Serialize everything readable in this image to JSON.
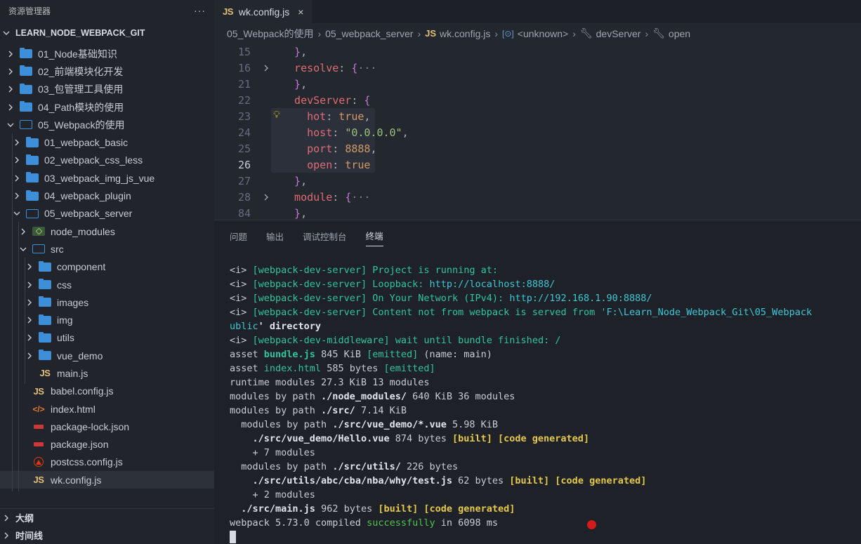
{
  "sidebar": {
    "title": "资源管理器",
    "more": "···",
    "project": "LEARN_NODE_WEBPACK_GIT",
    "tree": [
      {
        "label": "01_Node基础知识"
      },
      {
        "label": "02_前端模块化开发"
      },
      {
        "label": "03_包管理工具使用"
      },
      {
        "label": "04_Path模块的使用"
      },
      {
        "label": "05_Webpack的使用"
      },
      {
        "label": "01_webpack_basic"
      },
      {
        "label": "02_webpack_css_less"
      },
      {
        "label": "03_webpack_img_js_vue"
      },
      {
        "label": "04_webpack_plugin"
      },
      {
        "label": "05_webpack_server"
      },
      {
        "label": "node_modules"
      },
      {
        "label": "src"
      },
      {
        "label": "component"
      },
      {
        "label": "css"
      },
      {
        "label": "images"
      },
      {
        "label": "img"
      },
      {
        "label": "utils"
      },
      {
        "label": "vue_demo"
      },
      {
        "label": "main.js"
      },
      {
        "label": "babel.config.js"
      },
      {
        "label": "index.html"
      },
      {
        "label": "package-lock.json"
      },
      {
        "label": "package.json"
      },
      {
        "label": "postcss.config.js"
      },
      {
        "label": "wk.config.js"
      }
    ],
    "outline": "大纲",
    "timeline": "时间线"
  },
  "editor": {
    "tab": {
      "icon": "JS",
      "label": "wk.config.js",
      "close": "×"
    },
    "breadcrumb": [
      "05_Webpack的使用",
      "05_webpack_server",
      "wk.config.js",
      "<unknown>",
      "devServer",
      "open"
    ],
    "breadcrumb_js": "JS",
    "lines": [
      {
        "n": "15",
        "text": "  },"
      },
      {
        "n": "16",
        "text": "  resolve: {···"
      },
      {
        "n": "21",
        "text": "  },"
      },
      {
        "n": "22",
        "text": "  devServer: {"
      },
      {
        "n": "23",
        "text": "    hot: true,"
      },
      {
        "n": "24",
        "text": "    host: \"0.0.0.0\","
      },
      {
        "n": "25",
        "text": "    port: 8888,"
      },
      {
        "n": "26",
        "text": "    open: true"
      },
      {
        "n": "27",
        "text": "  },"
      },
      {
        "n": "28",
        "text": "  module: {···"
      },
      {
        "n": "84",
        "text": "  },"
      }
    ]
  },
  "panel": {
    "tabs": [
      "问题",
      "输出",
      "调试控制台",
      "终端"
    ],
    "active_tab": "终端",
    "terminal": {
      "l1_tag": "<i>",
      "l1_src": "[webpack-dev-server]",
      "l1_msg": "Project is running at:",
      "l2_tag": "<i>",
      "l2_src": "[webpack-dev-server]",
      "l2_msg": "Loopback:",
      "l2_url": "http://localhost:8888/",
      "l3_tag": "<i>",
      "l3_src": "[webpack-dev-server]",
      "l3_msg": "On Your Network (IPv4):",
      "l3_url": "http://192.168.1.90:8888/",
      "l4_tag": "<i>",
      "l4_src": "[webpack-dev-server]",
      "l4_msg": "Content not from webpack is served from '",
      "l4_path": "F:\\Learn_Node_Webpack_Git\\05_Webpack",
      "l5_path": "ublic",
      "l5_rest": "' directory",
      "l6_tag": "<i>",
      "l6_src": "[webpack-dev-middleware]",
      "l6_msg": "wait until bundle finished: /",
      "l7_a": "asset ",
      "l7_b": "bundle.js",
      "l7_c": " 845 KiB ",
      "l7_d": "[emitted]",
      "l7_e": " (name: main)",
      "l8_a": "asset ",
      "l8_b": "index.html",
      "l8_c": " 585 bytes ",
      "l8_d": "[emitted]",
      "l9": "runtime modules 27.3 KiB 13 modules",
      "l10_a": "modules by path ",
      "l10_b": "./node_modules/",
      "l10_c": " 640 KiB 36 modules",
      "l11_a": "modules by path ",
      "l11_b": "./src/",
      "l11_c": " 7.14 KiB",
      "l12_a": "  modules by path ",
      "l12_b": "./src/vue_demo/*.vue",
      "l12_c": " 5.98 KiB",
      "l13_a": "    ",
      "l13_b": "./src/vue_demo/Hello.vue",
      "l13_c": " 874 bytes ",
      "l13_d": "[built] [code generated]",
      "l14": "    + 7 modules",
      "l15_a": "  modules by path ",
      "l15_b": "./src/utils/",
      "l15_c": " 226 bytes",
      "l16_a": "    ",
      "l16_b": "./src/utils/abc/cba/nba/why/test.js",
      "l16_c": " 62 bytes ",
      "l16_d": "[built] [code generated]",
      "l17": "    + 2 modules",
      "l18_a": "  ",
      "l18_b": "./src/main.js",
      "l18_c": " 962 bytes ",
      "l18_d": "[built] [code generated]",
      "l19_a": "webpack 5.73.0 compiled ",
      "l19_b": "successfully",
      "l19_c": " in 6098 ms"
    }
  }
}
